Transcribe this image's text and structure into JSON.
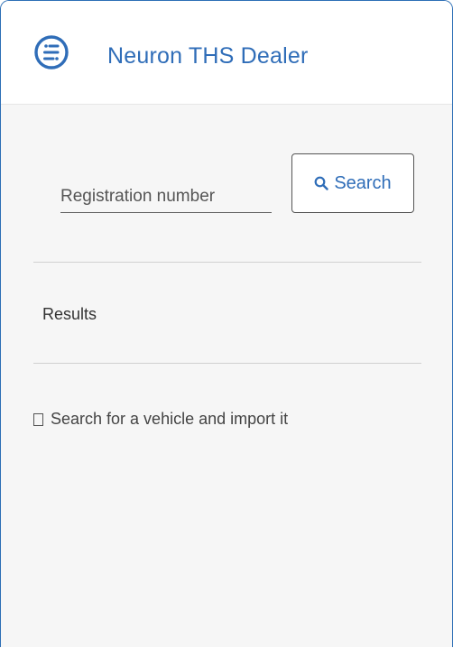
{
  "header": {
    "title": "Neuron THS Dealer",
    "logo_icon": "menu-lines-circle-icon",
    "accent_color": "#2f6db8"
  },
  "search": {
    "placeholder": "Registration number",
    "value": "",
    "button_label": "Search",
    "button_icon": "search-icon"
  },
  "results": {
    "heading": "Results",
    "empty_message": "Search for a vehicle and import it"
  }
}
